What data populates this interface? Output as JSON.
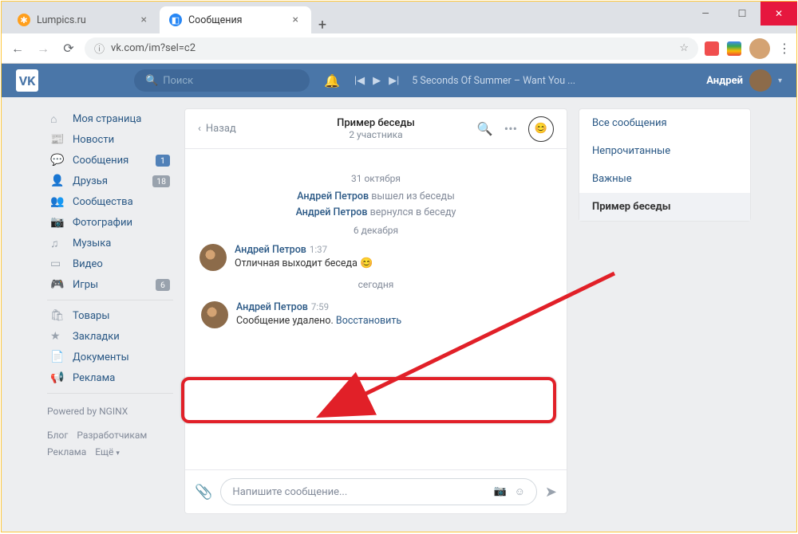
{
  "window": {
    "minimize": "—",
    "maximize": "☐",
    "close": "✕"
  },
  "tabs": [
    {
      "icon_color": "#ff9f1c",
      "title": "Lumpics.ru"
    },
    {
      "icon_color": "#2787f5",
      "title": "Сообщения"
    }
  ],
  "toolbar": {
    "back": "←",
    "forward": "→",
    "reload": "⟳",
    "url_scheme": "ⓘ",
    "url": "vk.com/im?sel=c2",
    "star": "☆"
  },
  "vk": {
    "logo": "VK",
    "search_icon": "🔍",
    "search_placeholder": "Поиск",
    "bell": "🔔",
    "player": {
      "prev": "|◀",
      "play": "▶",
      "next": "▶|",
      "track": "5 Seconds Of Summer – Want You ..."
    },
    "user_name": "Андрей",
    "chevron": "▾"
  },
  "nav": {
    "items": [
      {
        "icon": "⌂",
        "label": "Моя страница"
      },
      {
        "icon": "📰",
        "label": "Новости"
      },
      {
        "icon": "💬",
        "label": "Сообщения",
        "badge": "1",
        "badge_blue": true
      },
      {
        "icon": "👤",
        "label": "Друзья",
        "badge": "18"
      },
      {
        "icon": "👥",
        "label": "Сообщества"
      },
      {
        "icon": "📷",
        "label": "Фотографии"
      },
      {
        "icon": "♫",
        "label": "Музыка"
      },
      {
        "icon": "▭",
        "label": "Видео"
      },
      {
        "icon": "🎮",
        "label": "Игры",
        "badge": "6"
      }
    ],
    "items2": [
      {
        "icon": "🛍",
        "label": "Товары"
      },
      {
        "icon": "★",
        "label": "Закладки"
      },
      {
        "icon": "📄",
        "label": "Документы"
      },
      {
        "icon": "📢",
        "label": "Реклама"
      }
    ],
    "powered": "Powered by NGINX",
    "footer_links": [
      "Блог",
      "Разработчикам",
      "Реклама",
      "Ещё"
    ]
  },
  "chat": {
    "back": "Назад",
    "title": "Пример беседы",
    "subtitle": "2 участника",
    "search_icon": "🔍",
    "more": "•••",
    "avatar_face": "😊",
    "dates": {
      "d1": "31 октября",
      "d2": "6 декабря",
      "d3": "сегодня"
    },
    "sys1_name": "Андрей Петров",
    "sys1_text": " вышел из беседы",
    "sys2_name": "Андрей Петров",
    "sys2_text": " вернулся в беседу",
    "msg1": {
      "name": "Андрей Петров",
      "time": "1:37",
      "text": "Отличная выходит беседа ",
      "emoji": "😊"
    },
    "msg2": {
      "name": "Андрей Петров",
      "time": "7:59",
      "text": "Сообщение удалено. ",
      "restore": "Восстановить"
    },
    "input_placeholder": "Напишите сообщение...",
    "clip": "📎",
    "camera": "📷",
    "smile": "☺",
    "send": "➤"
  },
  "right": {
    "items": [
      "Все сообщения",
      "Непрочитанные",
      "Важные",
      "Пример беседы"
    ],
    "active_index": 3
  }
}
